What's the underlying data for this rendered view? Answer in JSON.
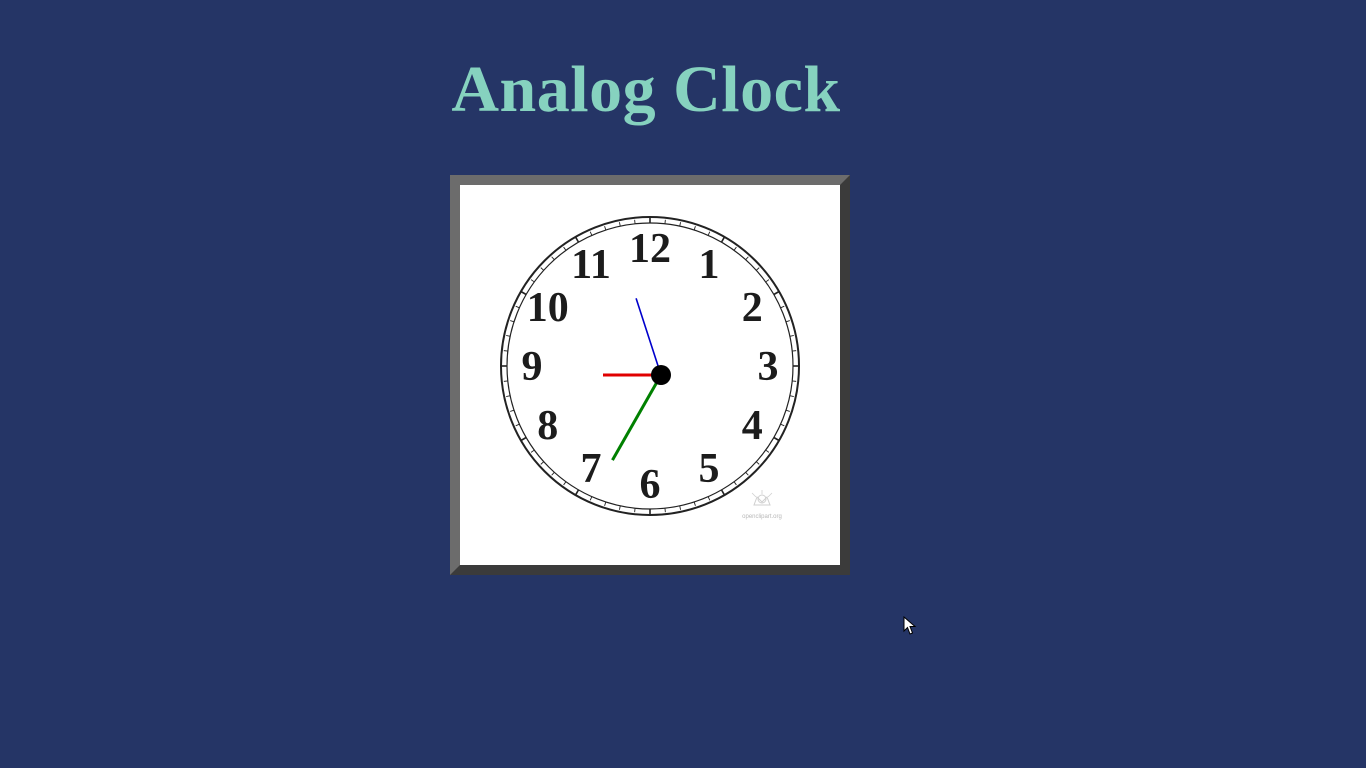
{
  "page": {
    "title": "Analog Clock"
  },
  "clock": {
    "numerals": [
      "12",
      "1",
      "2",
      "3",
      "4",
      "5",
      "6",
      "7",
      "8",
      "9",
      "10",
      "11"
    ],
    "time": {
      "hours": 9,
      "minutes": 34,
      "seconds": 57
    },
    "watermark": "openclipart.org",
    "colors": {
      "background": "#253566",
      "title": "#86d2bf",
      "hour_hand": "#e00000",
      "minute_hand": "#008000",
      "second_hand": "#0000cc",
      "hub": "#000000",
      "face": "#ffffff",
      "frame_light": "#6c6c6c",
      "frame_dark": "#3b3b3b"
    }
  }
}
